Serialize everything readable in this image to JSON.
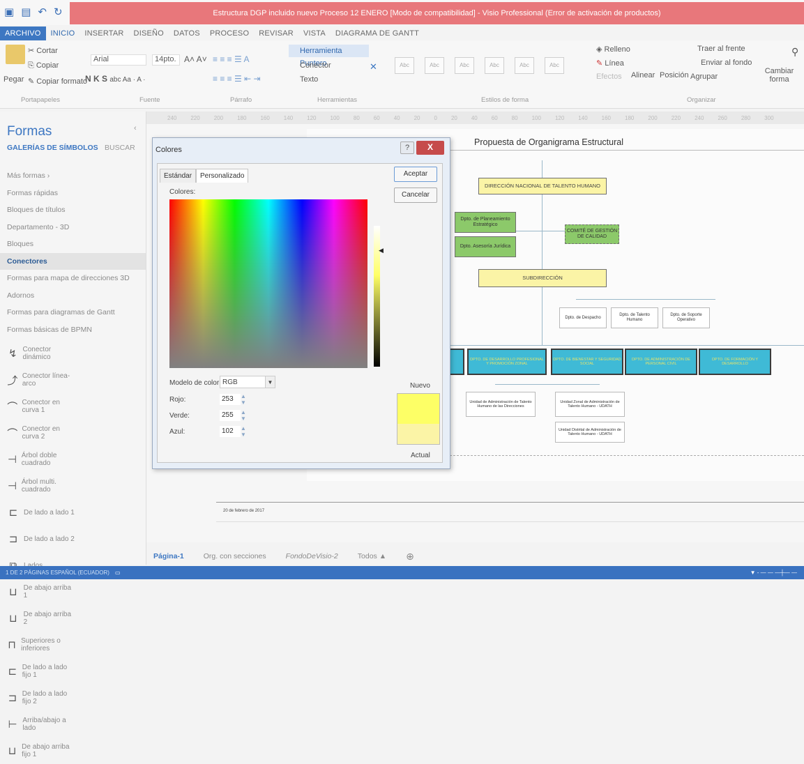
{
  "titlebar": {
    "title": "Estructura DGP incluido nuevo Proceso 12 ENERO [Modo de compatibilidad] - Visio Professional (Error de activación de productos)"
  },
  "tabs": [
    "ARCHIVO",
    "INICIO",
    "INSERTAR",
    "DISEÑO",
    "DATOS",
    "PROCESO",
    "REVISAR",
    "VISTA",
    "DIAGRAMA DE GANTT"
  ],
  "ribbon": {
    "paste": "Pegar",
    "cut": "Cortar",
    "copy": "Copiar",
    "format_painter": "Copiar formato",
    "font_name": "Arial",
    "font_size": "14pto.",
    "pointer_tool": "Herramienta Puntero",
    "connector": "Conector",
    "text": "Texto",
    "fill": "Relleno",
    "line": "Línea",
    "effects": "Efectos",
    "bring_front": "Traer al frente",
    "send_back": "Enviar al fondo",
    "group": "Agrupar",
    "align": "Alinear",
    "position": "Posición",
    "change_shape": "Cambiar forma",
    "style_label": "Abc",
    "groups": [
      "Portapapeles",
      "Fuente",
      "Párrafo",
      "Herramientas",
      "Estilos de forma",
      "Organizar"
    ]
  },
  "ruler": [
    "240",
    "220",
    "200",
    "180",
    "160",
    "140",
    "120",
    "100",
    "80",
    "60",
    "40",
    "20",
    "0",
    "20",
    "40",
    "60",
    "80",
    "100",
    "120",
    "140",
    "160",
    "180",
    "200",
    "220",
    "240",
    "260",
    "280",
    "300"
  ],
  "shapes_panel": {
    "title": "Formas",
    "gallery": "GALERÍAS DE SÍMBOLOS",
    "search": "BUSCAR",
    "items": [
      "Más formas",
      "Formas rápidas",
      "Bloques de títulos",
      "Departamento - 3D",
      "Bloques",
      "Conectores",
      "Formas para mapa de direcciones 3D",
      "Adornos",
      "Formas para diagramas de Gantt",
      "Formas básicas de BPMN"
    ],
    "stencils": [
      [
        "Conector dinámico",
        "Conector línea-arco"
      ],
      [
        "Conector en curva 1",
        "Conector en curva 2"
      ],
      [
        "Árbol doble cuadrado",
        "Árbol multi. cuadrado"
      ],
      [
        "De lado a lado 1",
        "De lado a lado 2"
      ],
      [
        "Lados",
        "De abajo arriba 1"
      ],
      [
        "De abajo arriba 2",
        "Superiores o inferiores"
      ],
      [
        "De lado a lado fijo 1",
        "De lado a lado fijo 2"
      ],
      [
        "Arriba/abajo a lado",
        "De abajo arriba fijo 1"
      ]
    ]
  },
  "diagram": {
    "title": "Propuesta de Organigrama Estructural",
    "direccion": "DIRECCIÓN NACIONAL DE TALENTO HUMANO",
    "planeamiento": "Dpto. de Planeamiento Estratégico",
    "asesoria": "Dpto. Asesoría Jurídica",
    "comite": "COMITÉ DE GESTIÓN DE CALIDAD",
    "subdireccion": "SUBDIRECCIÓN",
    "despacho": "Dpto. de Despacho",
    "talento": "Dpto. de Talento Humano",
    "soporte": "Dpto. de Soporte Operativo",
    "cyan_boxes": [
      "DPTO. DE DESARROLLO PROFESIONAL Y PROMOCIÓN ZONAL",
      "DPTO. DE BIENESTAR Y SEGURIDAD SOCIAL",
      "DPTO. DE ADMINISTRACIÓN DE PERSONAL CIVIL",
      "DPTO. DE FORMACIÓN Y DESARROLLO"
    ],
    "unit1": "Unidad de Administración de Talento Humano de las Direcciones",
    "unit2": "Unidad Zonal de Administración de Talento Humano - UDATH",
    "unit3": "Unidad Distrital de Administración de Talento Humano - UDATH",
    "date": "20 de febrero de 2017"
  },
  "dialog": {
    "title": "Colores",
    "help": "?",
    "close": "X",
    "tab_standard": "Estándar",
    "tab_custom": "Personalizado",
    "colors_label": "Colores:",
    "ok": "Aceptar",
    "cancel": "Cancelar",
    "model_label": "Modelo de color:",
    "model_value": "RGB",
    "red_label": "Rojo:",
    "red": "253",
    "green_label": "Verde:",
    "green": "255",
    "blue_label": "Azul:",
    "blue": "102",
    "new": "Nuevo",
    "current": "Actual",
    "new_color": "#fdff66",
    "current_color": "#fbf4a6"
  },
  "bottom_tabs": [
    "Página-1",
    "Org. con secciones",
    "FondoDeVisio-2",
    "Todos ▲",
    "⊕"
  ],
  "status": {
    "text": "1 DE 2 PÁGINAS   ESPAÑOL (ECUADOR)"
  }
}
